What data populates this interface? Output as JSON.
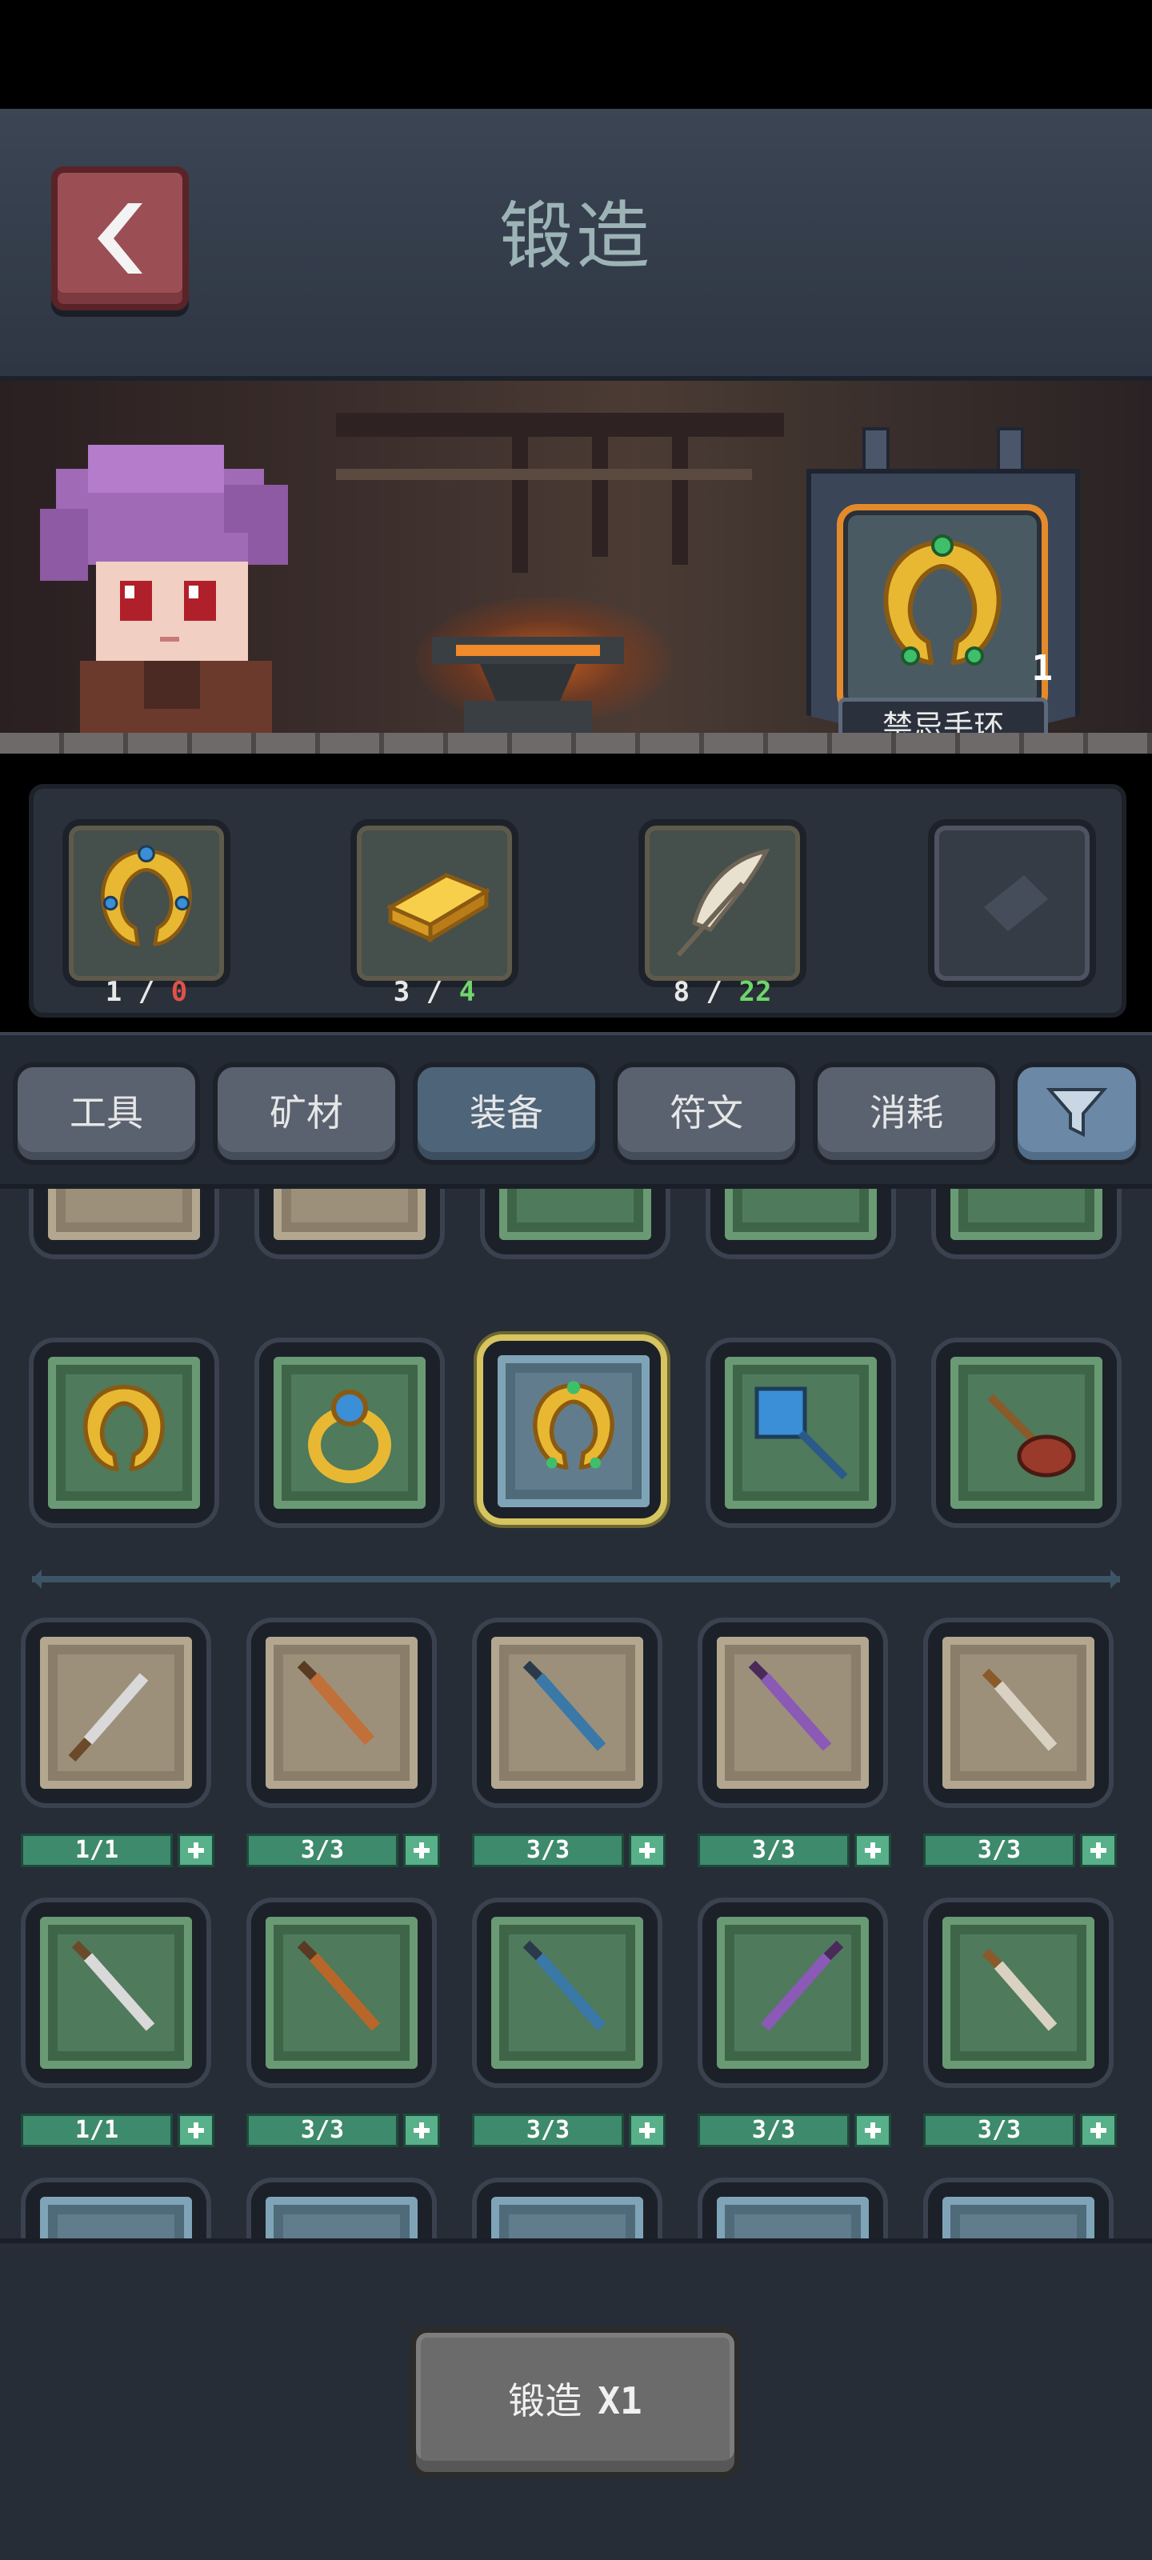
{
  "header": {
    "title": "锻造",
    "back_label": ""
  },
  "result": {
    "name": "禁忌手环",
    "count": "1",
    "icon": "gold-ring-icon"
  },
  "materials": [
    {
      "icon": "gold-ring-icon",
      "have": "1",
      "need": "0",
      "need_color": "red"
    },
    {
      "icon": "gold-bar-icon",
      "have": "3",
      "need": "4",
      "need_color": "green"
    },
    {
      "icon": "feather-icon",
      "have": "8",
      "need": "22",
      "need_color": "green"
    },
    {
      "icon": "empty-slot-icon",
      "have": "",
      "need": "",
      "need_color": ""
    }
  ],
  "tabs": [
    {
      "label": "工具",
      "active": false
    },
    {
      "label": "矿材",
      "active": false
    },
    {
      "label": "装备",
      "active": true
    },
    {
      "label": "符文",
      "active": false
    },
    {
      "label": "消耗",
      "active": false
    }
  ],
  "recipes_top": [
    {
      "icon": "gold-ring-icon",
      "paper": "green"
    },
    {
      "icon": "blue-gem-ring-icon",
      "paper": "green"
    },
    {
      "icon": "gold-ring-icon",
      "paper": "blue",
      "selected": true
    },
    {
      "icon": "fly-swatter-icon",
      "paper": "green"
    },
    {
      "icon": "plunger-icon",
      "paper": "green"
    }
  ],
  "weapons_tan": [
    {
      "icon": "dagger-icon",
      "qty": "1/1"
    },
    {
      "icon": "cleaver-icon",
      "qty": "3/3"
    },
    {
      "icon": "blue-sword-icon",
      "qty": "3/3"
    },
    {
      "icon": "purple-sword-icon",
      "qty": "3/3"
    },
    {
      "icon": "short-blade-icon",
      "qty": "3/3"
    }
  ],
  "weapons_green": [
    {
      "icon": "dagger-icon",
      "qty": "1/1"
    },
    {
      "icon": "serrated-blade-icon",
      "qty": "3/3"
    },
    {
      "icon": "blue-sword-icon",
      "qty": "3/3"
    },
    {
      "icon": "purple-sword-icon",
      "qty": "3/3"
    },
    {
      "icon": "short-blade-icon",
      "qty": "3/3"
    }
  ],
  "forge_button": {
    "label": "锻造",
    "multiplier": "X1"
  },
  "colors": {
    "accent": "#e48a2a",
    "selected": "#d6c560",
    "green_count": "#6fd66b",
    "red_count": "#e0514a"
  }
}
